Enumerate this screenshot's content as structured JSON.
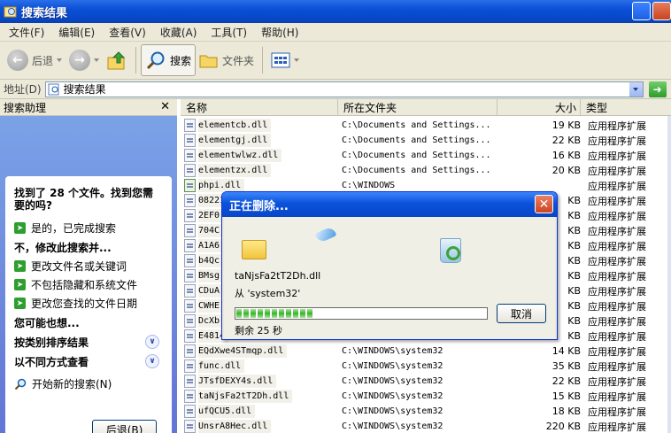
{
  "window": {
    "title": "搜索结果"
  },
  "menu": [
    "文件(F)",
    "编辑(E)",
    "查看(V)",
    "收藏(A)",
    "工具(T)",
    "帮助(H)"
  ],
  "toolbar": {
    "back": "后退",
    "search": "搜索",
    "folders": "文件夹"
  },
  "address": {
    "label": "地址(D)",
    "value": "搜索结果"
  },
  "left": {
    "header": "搜索助理",
    "found": "找到了 28 个文件。找到您需要的吗?",
    "yes": "是的，已完成搜索",
    "refine": "不，修改此搜索并...",
    "opt1": "更改文件名或关键词",
    "opt2": "不包括隐藏和系统文件",
    "opt3": "更改您查找的文件日期",
    "maybe": "您可能也想...",
    "sort": "按类别排序结果",
    "view": "以不同方式查看",
    "new_search": "开始新的搜索(N)",
    "back_btn": "后退(B)"
  },
  "columns": {
    "name": "名称",
    "folder": "所在文件夹",
    "size": "大小",
    "type": "类型"
  },
  "files": [
    {
      "name": "elementcb.dll",
      "folder": "C:\\Documents and Settings...",
      "size": "19 KB",
      "type": "应用程序扩展"
    },
    {
      "name": "elementgj.dll",
      "folder": "C:\\Documents and Settings...",
      "size": "22 KB",
      "type": "应用程序扩展"
    },
    {
      "name": "elementwlwz.dll",
      "folder": "C:\\Documents and Settings...",
      "size": "16 KB",
      "type": "应用程序扩展"
    },
    {
      "name": "elementzx.dll",
      "folder": "C:\\Documents and Settings...",
      "size": "20 KB",
      "type": "应用程序扩展"
    },
    {
      "name": "phpi.dll",
      "folder": "C:\\WINDOWS",
      "size": "",
      "type": "应用程序扩展"
    },
    {
      "name": "08221",
      "folder": "",
      "size": "KB",
      "type": "应用程序扩展"
    },
    {
      "name": "2EF0",
      "folder": "",
      "size": "KB",
      "type": "应用程序扩展"
    },
    {
      "name": "704C",
      "folder": "",
      "size": "KB",
      "type": "应用程序扩展"
    },
    {
      "name": "A1A6",
      "folder": "",
      "size": "KB",
      "type": "应用程序扩展"
    },
    {
      "name": "b4Qc",
      "folder": "",
      "size": "KB",
      "type": "应用程序扩展"
    },
    {
      "name": "BMsg",
      "folder": "",
      "size": "KB",
      "type": "应用程序扩展"
    },
    {
      "name": "CDuA",
      "folder": "",
      "size": "KB",
      "type": "应用程序扩展"
    },
    {
      "name": "CWHE",
      "folder": "",
      "size": "KB",
      "type": "应用程序扩展"
    },
    {
      "name": "DcXb",
      "folder": "",
      "size": "KB",
      "type": "应用程序扩展"
    },
    {
      "name": "E4814",
      "folder": "",
      "size": "KB",
      "type": "应用程序扩展"
    },
    {
      "name": "EQdXwe4STmqp.dll",
      "folder": "C:\\WINDOWS\\system32",
      "size": "14 KB",
      "type": "应用程序扩展"
    },
    {
      "name": "func.dll",
      "folder": "C:\\WINDOWS\\system32",
      "size": "35 KB",
      "type": "应用程序扩展"
    },
    {
      "name": "JTsfDEXY4s.dll",
      "folder": "C:\\WINDOWS\\system32",
      "size": "22 KB",
      "type": "应用程序扩展"
    },
    {
      "name": "taNjsFa2tT2Dh.dll",
      "folder": "C:\\WINDOWS\\system32",
      "size": "15 KB",
      "type": "应用程序扩展"
    },
    {
      "name": "ufQCU5.dll",
      "folder": "C:\\WINDOWS\\system32",
      "size": "18 KB",
      "type": "应用程序扩展"
    },
    {
      "name": "UnsrA8Hec.dll",
      "folder": "C:\\WINDOWS\\system32",
      "size": "220 KB",
      "type": "应用程序扩展"
    }
  ],
  "dialog": {
    "title": "正在删除...",
    "file": "taNjsFa2tT2Dh.dll",
    "from": "从 'system32'",
    "remaining": "剩余 25 秒",
    "cancel": "取消",
    "progress": 0.31
  }
}
